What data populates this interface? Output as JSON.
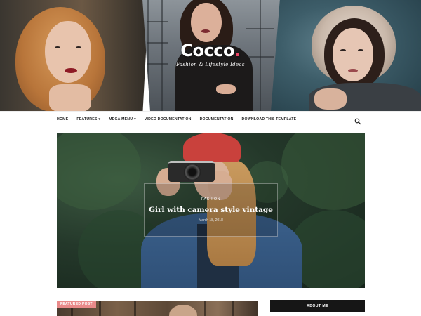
{
  "header": {
    "logo": "Cocco",
    "logo_dot": ".",
    "tagline": "Fashion & Lifestyle Ideas"
  },
  "nav": {
    "items": [
      {
        "label": "HOME",
        "has_dropdown": false
      },
      {
        "label": "FEATURES",
        "has_dropdown": true
      },
      {
        "label": "MEGA MENU",
        "has_dropdown": true
      },
      {
        "label": "VIDEO DOCUMENTATION",
        "has_dropdown": false
      },
      {
        "label": "DOCUMENTATION",
        "has_dropdown": false
      },
      {
        "label": "DOWNLOAD THIS TEMPLATE",
        "has_dropdown": false
      }
    ],
    "dropdown_icon": "caret-down-icon",
    "search_icon": "search-icon"
  },
  "hero": {
    "category": "FASHION",
    "title": "Girl with camera style vintage",
    "date": "March 18, 2018"
  },
  "featured": {
    "badge": "FEATURED POST"
  },
  "sidebar": {
    "about_label": "ABOUT ME"
  },
  "colors": {
    "accent": "#e94363",
    "badge": "#e98a8a",
    "sidebar_header": "#161616"
  }
}
